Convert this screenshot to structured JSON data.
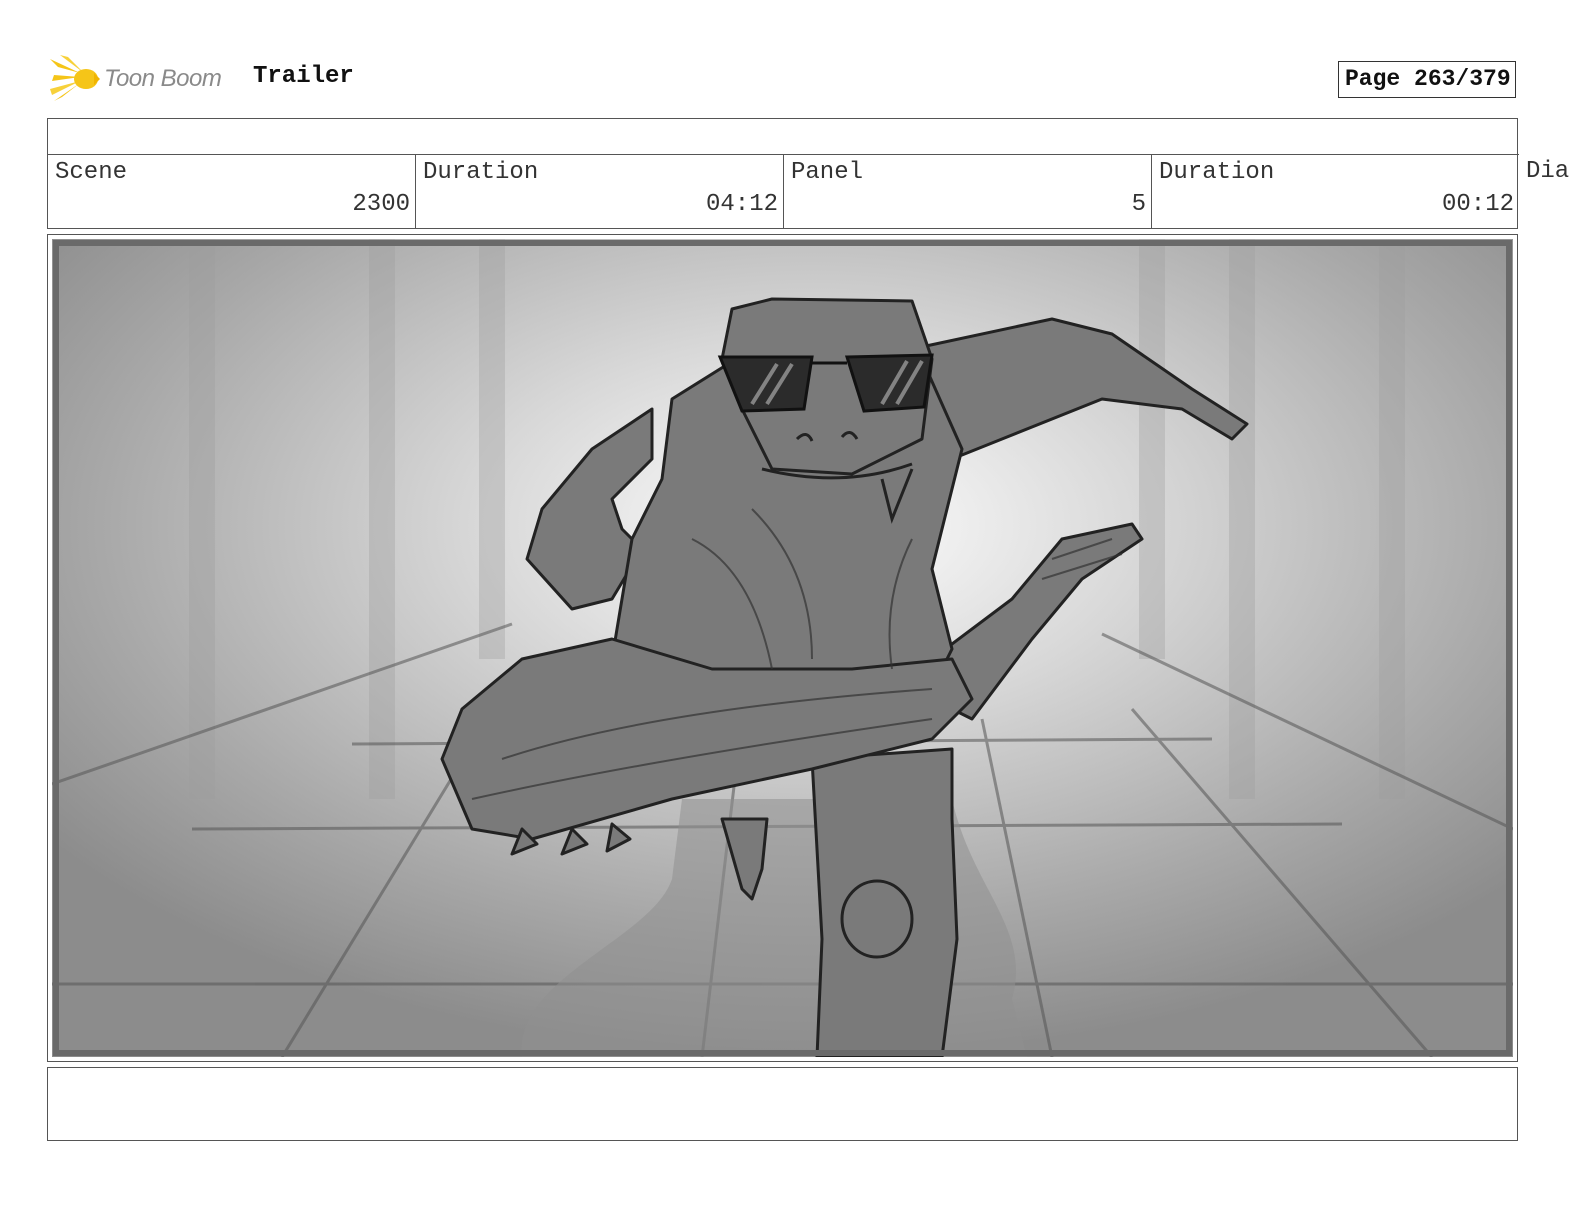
{
  "header": {
    "logo_text": "Toon Boom",
    "project_title": "Trailer",
    "page_label": "Page 263/379"
  },
  "info": {
    "scene_label": "Scene",
    "scene_value": "2300",
    "scene_duration_label": "Duration",
    "scene_duration_value": "04:12",
    "panel_label": "Panel",
    "panel_value": "5",
    "panel_duration_label": "Duration",
    "panel_duration_value": "00:12",
    "dialogue_label": "Dia"
  },
  "frame": {
    "image_icon": "storyboard-sketch"
  },
  "colors": {
    "logo_yellow": "#f5c518",
    "border": "#555555"
  }
}
